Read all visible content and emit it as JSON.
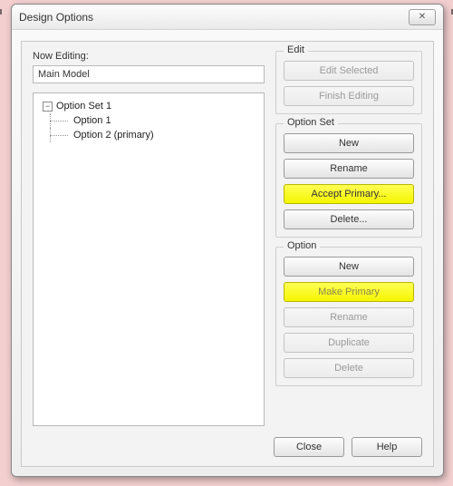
{
  "window": {
    "title": "Design Options",
    "close_glyph": "✕"
  },
  "nowEditing": {
    "label": "Now Editing:",
    "value": "Main Model"
  },
  "tree": {
    "root": "Option Set 1",
    "children": [
      "Option 1",
      "Option 2 (primary)"
    ]
  },
  "groups": {
    "edit": {
      "title": "Edit",
      "edit_selected": "Edit Selected",
      "finish_editing": "Finish Editing"
    },
    "option_set": {
      "title": "Option Set",
      "new": "New",
      "rename": "Rename",
      "accept_primary": "Accept Primary...",
      "delete": "Delete..."
    },
    "option": {
      "title": "Option",
      "new": "New",
      "make_primary": "Make Primary",
      "rename": "Rename",
      "duplicate": "Duplicate",
      "delete": "Delete"
    }
  },
  "footer": {
    "close": "Close",
    "help": "Help"
  }
}
